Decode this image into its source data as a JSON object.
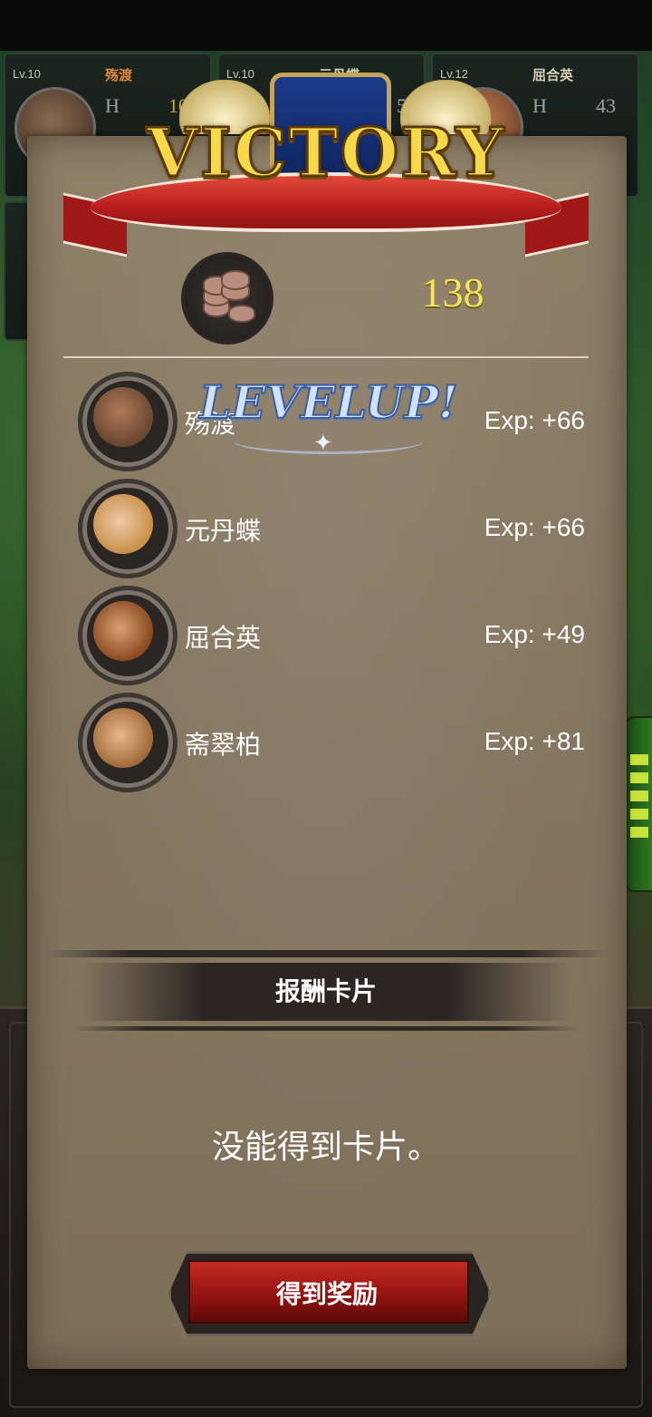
{
  "units_bar": [
    {
      "level": "Lv.10",
      "name": "殇渡",
      "hp_label": "H",
      "hp_value": "10"
    },
    {
      "level": "Lv.10",
      "name": "元丹蝶",
      "hp_label": "",
      "hp_value": "5"
    },
    {
      "level": "Lv.12",
      "name": "屈合英",
      "hp_label": "H",
      "hp_value": "43"
    }
  ],
  "banner": {
    "title": "VICTORY"
  },
  "reward": {
    "coin_icon": "coin-stack-icon",
    "coins": "138"
  },
  "levelup": {
    "label": "LEVELUP!"
  },
  "heroes": [
    {
      "name": "殇渡",
      "exp": "Exp: +66",
      "leveled_up": true
    },
    {
      "name": "元丹蝶",
      "exp": "Exp: +66"
    },
    {
      "name": "屈合英",
      "exp": "Exp: +49"
    },
    {
      "name": "斋翠柏",
      "exp": "Exp: +81"
    }
  ],
  "reward_cards": {
    "title": "报酬卡片",
    "message": "没能得到卡片。"
  },
  "buttons": {
    "claim": "得到奖励"
  },
  "colors": {
    "accent_gold": "#f5e55a",
    "button_red": "#c32b21",
    "parchment": "#857660"
  }
}
